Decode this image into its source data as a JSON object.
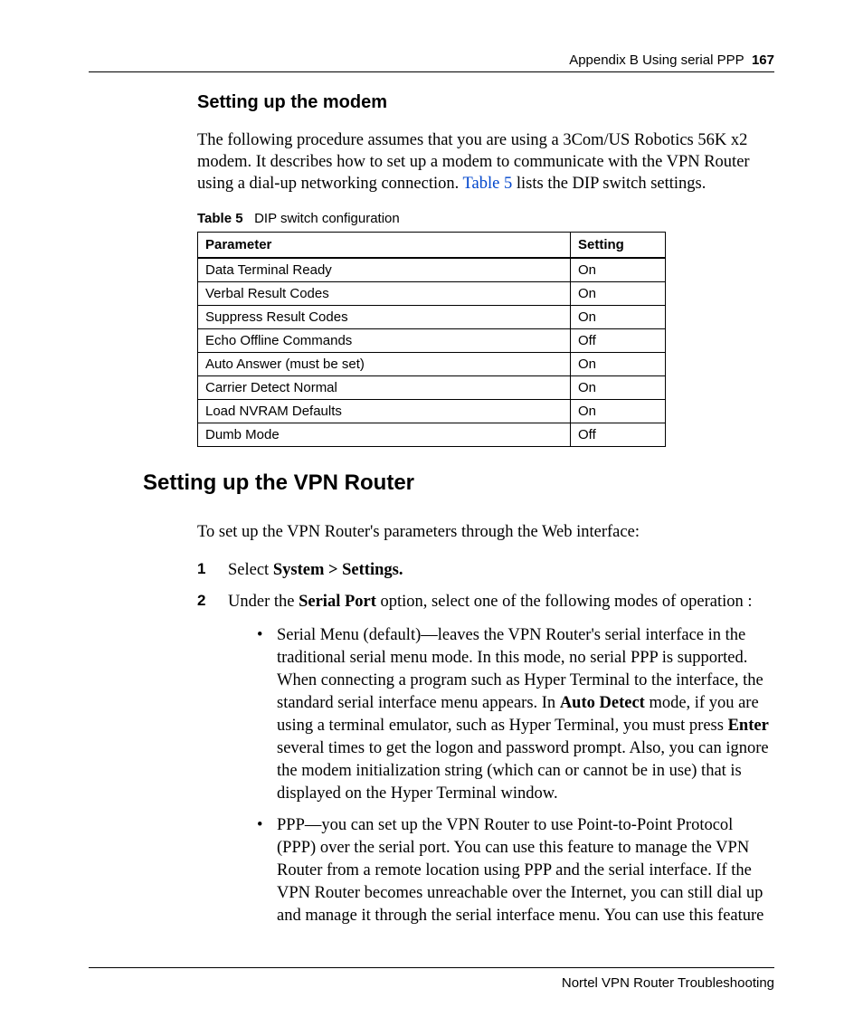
{
  "header": {
    "text": "Appendix B  Using serial PPP",
    "page_number": "167"
  },
  "subhead": "Setting up the modem",
  "intro_para": {
    "part1": "The following procedure assumes that you are using a 3Com/US Robotics 56K x2 modem. It describes how to set up a modem to communicate with the VPN Router using a dial-up networking connection. ",
    "xref": "Table 5",
    "part2": " lists the DIP switch settings."
  },
  "table": {
    "label": "Table 5",
    "caption": "DIP switch configuration",
    "head": {
      "col1": "Parameter",
      "col2": "Setting"
    },
    "rows": [
      {
        "param": "Data Terminal Ready",
        "setting": "On"
      },
      {
        "param": "Verbal Result Codes",
        "setting": "On"
      },
      {
        "param": "Suppress Result Codes",
        "setting": "On"
      },
      {
        "param": "Echo Offline Commands",
        "setting": "Off"
      },
      {
        "param": "Auto Answer (must be set)",
        "setting": "On"
      },
      {
        "param": "Carrier Detect Normal",
        "setting": "On"
      },
      {
        "param": "Load NVRAM Defaults",
        "setting": "On"
      },
      {
        "param": "Dumb Mode",
        "setting": "Off"
      }
    ]
  },
  "section_head": "Setting up the VPN Router",
  "section_intro": "To set up the VPN Router's parameters through the Web interface:",
  "steps": {
    "s1": {
      "num": "1",
      "pre": "Select ",
      "bold": "System > Settings."
    },
    "s2": {
      "num": "2",
      "pre": "Under the ",
      "bold": "Serial Port",
      "post": " option, select one of the following modes of operation :"
    }
  },
  "bullets": {
    "b1": {
      "part1": "Serial Menu (default)—leaves the VPN Router's serial interface in the traditional serial menu mode. In this mode, no serial PPP is supported. When connecting a program such as Hyper Terminal to the interface, the standard serial interface menu appears. In ",
      "bold1": "Auto Detect",
      "part2": " mode, if you are using a terminal emulator, such as Hyper Terminal, you must press ",
      "bold2": "Enter",
      "part3": " several times to get the logon and password prompt. Also, you can ignore the modem initialization string (which can or cannot be in use) that is displayed on the Hyper Terminal window."
    },
    "b2": "PPP—you can set up the VPN Router to use Point-to-Point Protocol (PPP) over the serial port. You can use this feature to manage the VPN Router from a remote location using PPP and the serial interface. If the VPN Router becomes unreachable over the Internet, you can still dial up and manage it through the serial interface menu. You can use this feature"
  },
  "footer": "Nortel VPN Router Troubleshooting"
}
